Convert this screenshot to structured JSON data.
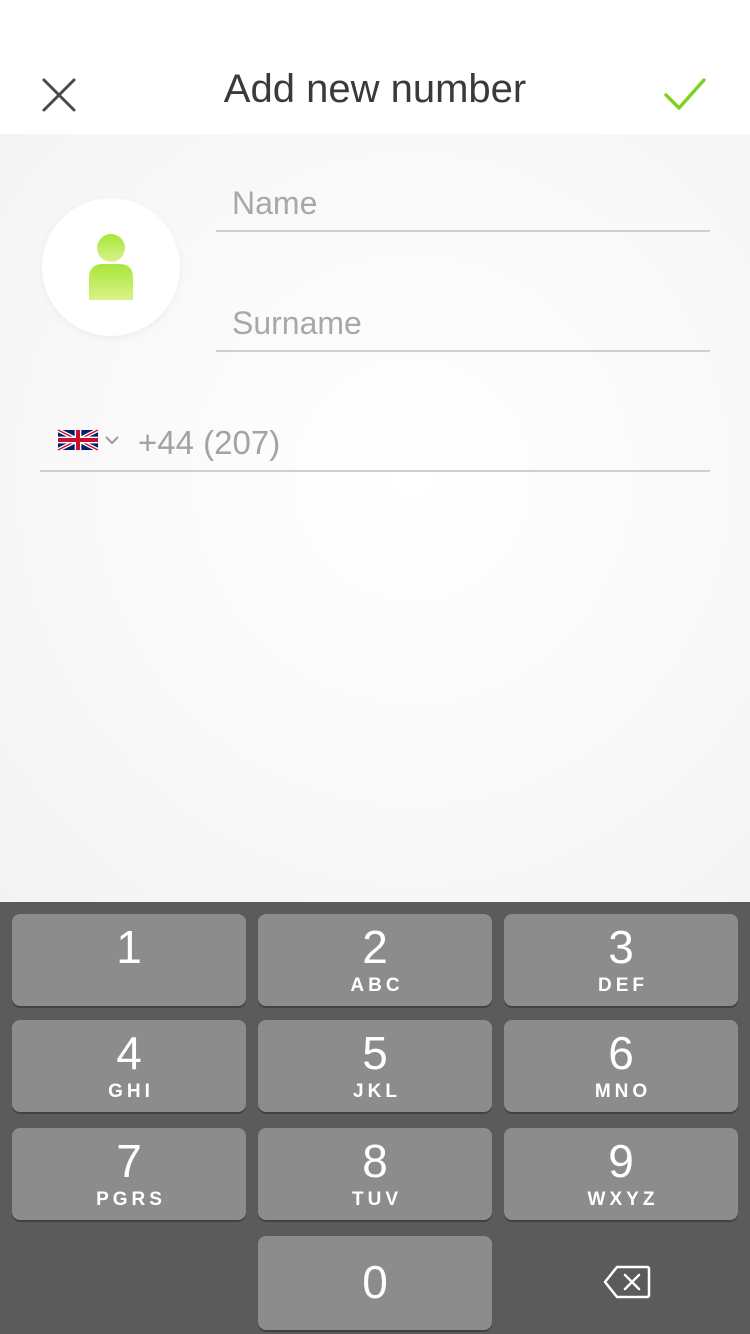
{
  "header": {
    "title": "Add new number"
  },
  "form": {
    "name_placeholder": "Name",
    "surname_placeholder": "Surname",
    "phone_value": "+44 (207)",
    "country": "GB"
  },
  "keypad": {
    "keys": [
      {
        "num": "1",
        "letters": ""
      },
      {
        "num": "2",
        "letters": "ABC"
      },
      {
        "num": "3",
        "letters": "DEF"
      },
      {
        "num": "4",
        "letters": "GHI"
      },
      {
        "num": "5",
        "letters": "JKL"
      },
      {
        "num": "6",
        "letters": "MNO"
      },
      {
        "num": "7",
        "letters": "PGRS"
      },
      {
        "num": "8",
        "letters": "TUV"
      },
      {
        "num": "9",
        "letters": "WXYZ"
      },
      {
        "num": "0",
        "letters": ""
      }
    ]
  },
  "colors": {
    "accent": "#7ed321",
    "avatar": "#c5ee72",
    "keypad_bg": "#5b5b5b",
    "key_bg": "#8c8c8c"
  },
  "icons": {
    "close": "close-icon",
    "confirm": "checkmark-icon",
    "avatar": "person-icon",
    "flag": "uk-flag-icon",
    "dropdown": "chevron-down-icon",
    "delete": "backspace-icon"
  }
}
